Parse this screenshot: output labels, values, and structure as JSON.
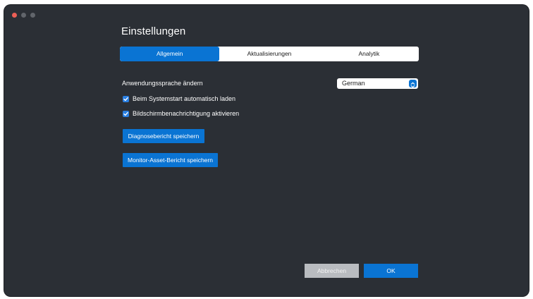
{
  "window": {
    "title": "Einstellungen"
  },
  "tabs": [
    {
      "label": "Allgemein",
      "active": true
    },
    {
      "label": "Aktualisierungen",
      "active": false
    },
    {
      "label": "Analytik",
      "active": false
    }
  ],
  "general": {
    "language_label": "Anwendungssprache ändern",
    "language_value": "German",
    "autostart_label": "Beim Systemstart automatisch laden",
    "autostart_checked": true,
    "notification_label": "Bildschirmbenachrichtigung aktivieren",
    "notification_checked": true,
    "diagnostic_button": "Diagnosebericht speichern",
    "monitor_asset_button": "Monitor-Asset-Bericht speichern"
  },
  "footer": {
    "cancel_label": "Abbrechen",
    "ok_label": "OK"
  },
  "colors": {
    "accent": "#0a74d3",
    "window_bg": "#2b2f35",
    "close_dot": "#ec5f56",
    "disabled_button": "#b9bcc0"
  }
}
